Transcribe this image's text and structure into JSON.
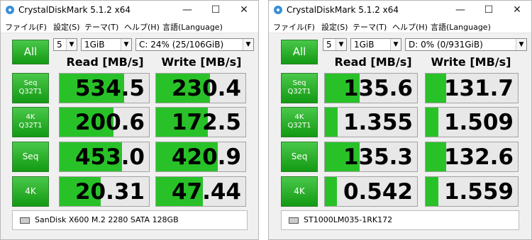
{
  "windows": [
    {
      "title": "CrystalDiskMark 5.1.2 x64",
      "menu": [
        "ファイル(F)",
        "設定(S)",
        "テーマ(T)",
        "ヘルプ(H)",
        "言語(Language)"
      ],
      "all_button": "All",
      "count_select": "5",
      "size_select": "1GiB",
      "drive_select": "C: 24% (25/106GiB)",
      "read_header": "Read [MB/s]",
      "write_header": "Write [MB/s]",
      "rows": [
        {
          "label_lines": [
            "Seq",
            "Q32T1"
          ],
          "read": "534.5",
          "write": "230.4"
        },
        {
          "label_lines": [
            "4K",
            "Q32T1"
          ],
          "read": "200.6",
          "write": "172.5"
        },
        {
          "label_lines": [
            "Seq"
          ],
          "read": "453.0",
          "write": "420.9"
        },
        {
          "label_lines": [
            "4K"
          ],
          "read": "20.31",
          "write": "47.44"
        }
      ],
      "status": "SanDisk X600 M.2 2280 SATA 128GB"
    },
    {
      "title": "CrystalDiskMark 5.1.2 x64",
      "menu": [
        "ファイル(F)",
        "設定(S)",
        "テーマ(T)",
        "ヘルプ(H)",
        "言語(Language)"
      ],
      "all_button": "All",
      "count_select": "5",
      "size_select": "1GiB",
      "drive_select": "D: 0% (0/931GiB)",
      "read_header": "Read [MB/s]",
      "write_header": "Write [MB/s]",
      "rows": [
        {
          "label_lines": [
            "Seq",
            "Q32T1"
          ],
          "read": "135.6",
          "write": "131.7"
        },
        {
          "label_lines": [
            "4K",
            "Q32T1"
          ],
          "read": "1.355",
          "write": "1.509"
        },
        {
          "label_lines": [
            "Seq"
          ],
          "read": "135.3",
          "write": "132.6"
        },
        {
          "label_lines": [
            "4K"
          ],
          "read": "0.542",
          "write": "1.559"
        }
      ],
      "status": "ST1000LM035-1RK172"
    }
  ],
  "colors": {
    "accent_green": "#139a13",
    "bar_green": "#28c228"
  }
}
